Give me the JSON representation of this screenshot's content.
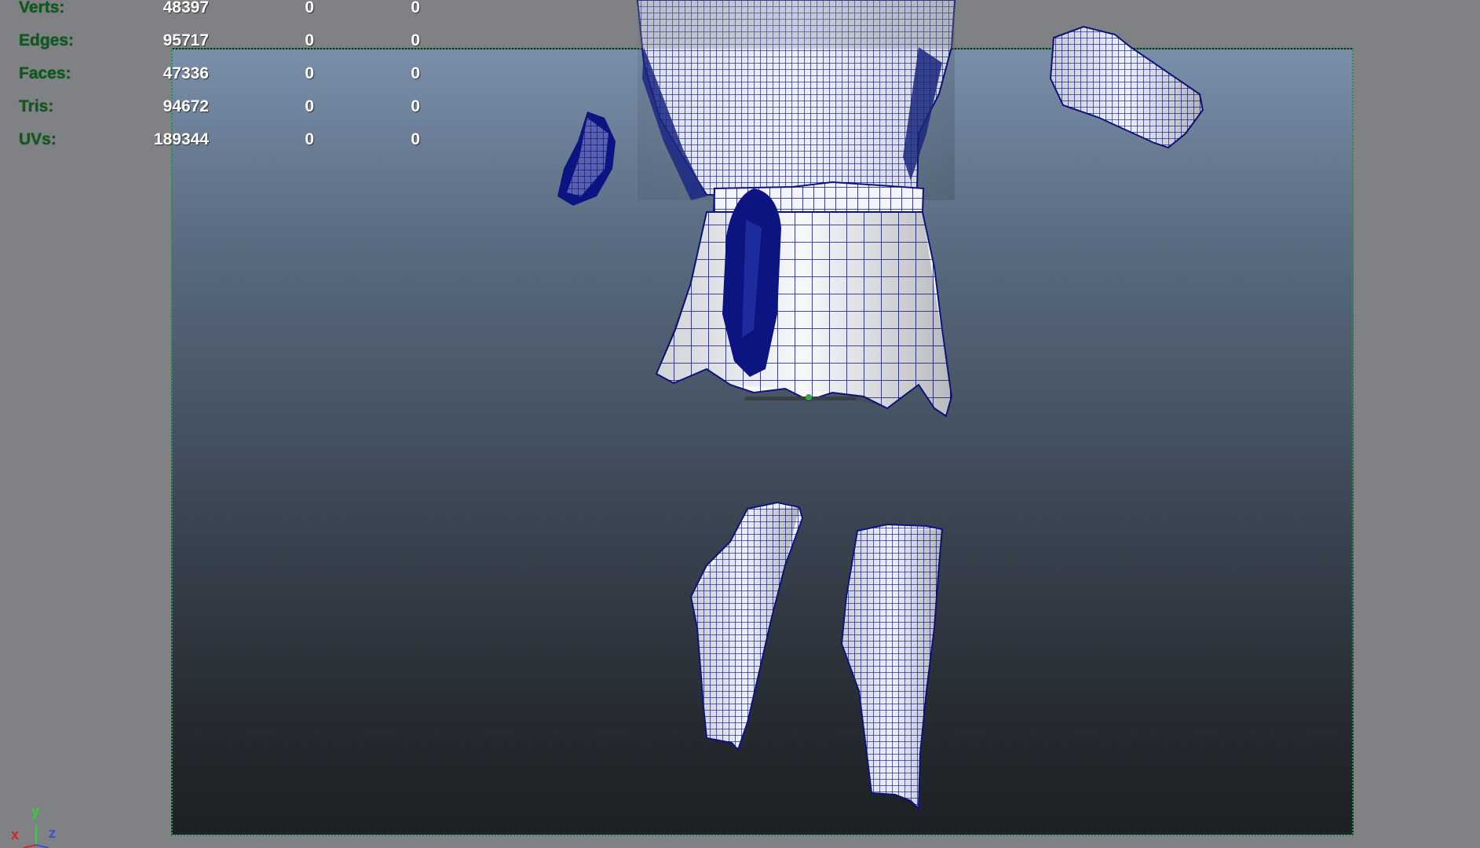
{
  "hud": {
    "rows": [
      {
        "label": "Verts:",
        "value": "48397",
        "col2": "0",
        "col3": "0"
      },
      {
        "label": "Edges:",
        "value": "95717",
        "col2": "0",
        "col3": "0"
      },
      {
        "label": "Faces:",
        "value": "47336",
        "col2": "0",
        "col3": "0"
      },
      {
        "label": "Tris:",
        "value": "94672",
        "col2": "0",
        "col3": "0"
      },
      {
        "label": "UVs:",
        "value": "189344",
        "col2": "0",
        "col3": "0"
      }
    ]
  },
  "axis": {
    "x": "x",
    "y": "y",
    "z": "z"
  },
  "colors": {
    "hud_label": "#0c5b1c",
    "wire": "#0b1480",
    "gate": "#2f8f3a",
    "axis_x": "#d42424",
    "axis_y": "#2fd42f",
    "axis_z": "#3a4fe0"
  }
}
